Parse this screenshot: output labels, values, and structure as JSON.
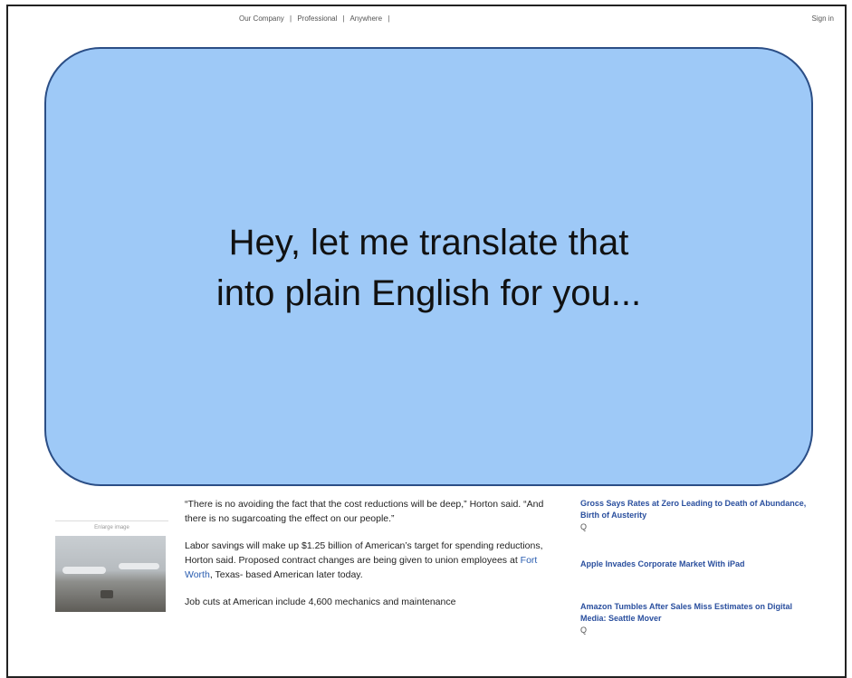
{
  "topnav": {
    "items": [
      "Our Company",
      "|",
      "Professional",
      "|",
      "Anywhere",
      "|"
    ],
    "signin": "Sign in"
  },
  "overlay": {
    "line1": "Hey, let me translate that",
    "line2": "into plain English for you..."
  },
  "left": {
    "enlarge": "Enlarge image"
  },
  "article": {
    "p1": "“There is no avoiding the fact that the cost reductions will be deep,” Horton said. “And there is no sugarcoating the effect on our people.”",
    "p2_pre": "Labor savings will make up $1.25 billion of American’s target for spending reductions, Horton said. Proposed contract changes are being given to union employees at ",
    "p2_link": "Fort Worth",
    "p2_post": ", Texas- based American later today.",
    "p3": "Job cuts at American include 4,600 mechanics and maintenance"
  },
  "right": {
    "headlines": [
      "Gross Says Rates at Zero Leading to Death of Abundance, Birth of Austerity",
      "Apple Invades Corporate Market With iPad",
      "Amazon Tumbles After Sales Miss Estimates on Digital Media: Seattle Mover"
    ],
    "q": "Q"
  },
  "colors": {
    "overlay_fill": "#9ec9f7",
    "overlay_border": "#2b4e86",
    "link": "#2a5db0",
    "headline": "#2a4f9e"
  }
}
